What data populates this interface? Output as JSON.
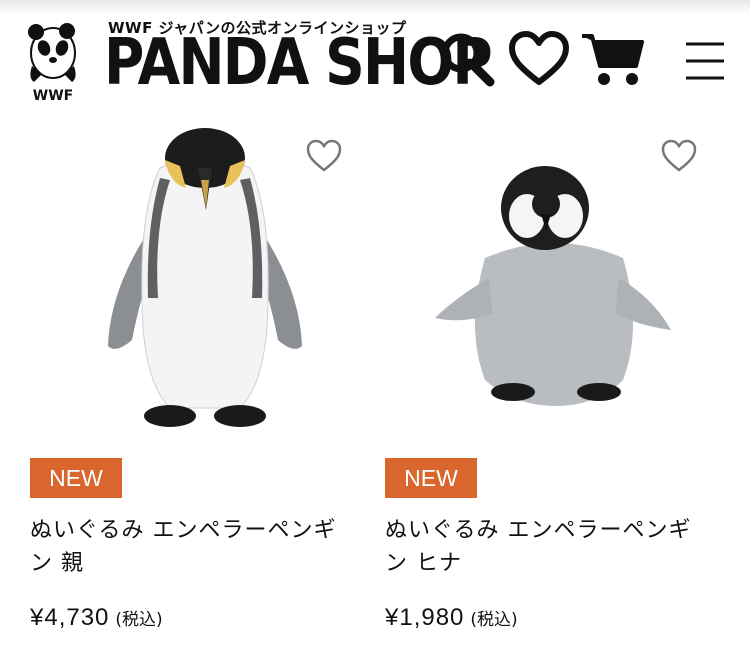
{
  "header": {
    "logo_text": "WWF",
    "subtitle": "WWF ジャパンの公式オンラインショップ",
    "title": "PANDA SHOP",
    "icons": [
      "search-icon",
      "heart-icon",
      "cart-icon",
      "menu-icon"
    ]
  },
  "products": [
    {
      "badge": "NEW",
      "name": "ぬいぐるみ エンペラーペンギン 親",
      "price": "¥4,730",
      "tax_note": "(税込)"
    },
    {
      "badge": "NEW",
      "name": "ぬいぐるみ エンペラーペンギン ヒナ",
      "price": "¥1,980",
      "tax_note": "(税込)"
    }
  ],
  "colors": {
    "badge": "#d9662d",
    "text": "#111111",
    "background": "#ffffff"
  }
}
